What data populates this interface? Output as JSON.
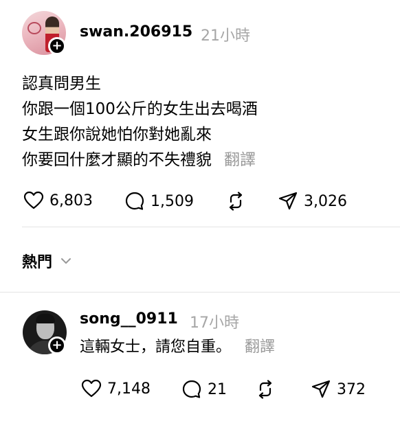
{
  "post": {
    "username": "swan.206915",
    "time": "21小時",
    "lines": [
      "認真問男生",
      "你跟一個100公斤的女生出去喝酒",
      "女生跟你說她怕你對她亂來",
      "你要回什麼才顯的不失禮貌"
    ],
    "translate_label": "翻譯",
    "likes": "6,803",
    "comments": "1,509",
    "shares": "3,026"
  },
  "sort": {
    "label": "熱門"
  },
  "reply": {
    "username": "song__0911",
    "time": "17小時",
    "text": "這輛女士，請您自重。",
    "translate_label": "翻譯",
    "likes": "7,148",
    "comments": "21",
    "shares": "372"
  },
  "icons": {
    "like": "heart-icon",
    "comment": "comment-icon",
    "repost": "repost-icon",
    "share": "send-icon",
    "follow": "plus-icon",
    "expand": "chevron-down-icon"
  }
}
